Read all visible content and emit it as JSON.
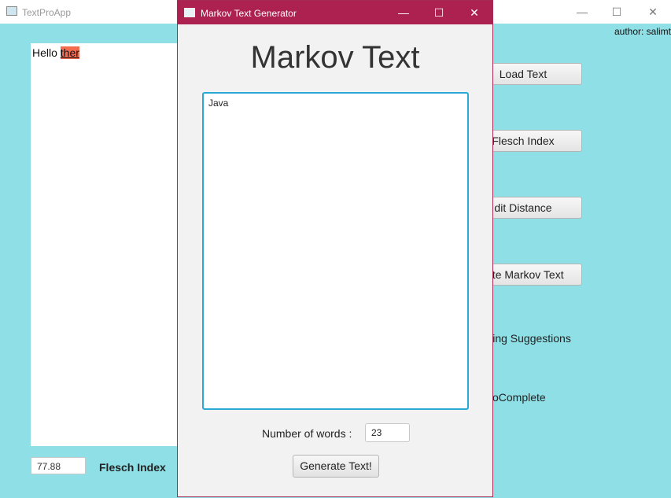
{
  "main_window": {
    "title": "TextProApp",
    "controls": {
      "minimize": "—",
      "maximize": "☐",
      "close": "✕"
    },
    "author": "author: salimt",
    "text": {
      "plain": "Hello ",
      "misspelled": "ther"
    },
    "flesch_value": "77.88",
    "flesch_label": "Flesch Index",
    "buttons": {
      "load_text": "Load Text",
      "flesch_index": "Flesch Index",
      "edit_distance": "dit Distance",
      "generate_markov": "rate Markov Text"
    },
    "labels": {
      "spelling_suggestions": "lling Suggestions",
      "autocomplete": "oComplete"
    }
  },
  "dialog": {
    "title": "Markov Text Generator",
    "controls": {
      "minimize": "—",
      "maximize": "☐",
      "close": "✕"
    },
    "heading": "Markov Text",
    "generated_text": "Java",
    "words_label": "Number of words :",
    "words_value": "23",
    "generate_button": "Generate Text!"
  },
  "colors": {
    "background": "#8fdfe6",
    "dialog_titlebar": "#ad2150",
    "highlight": "#f36c4f",
    "focus_border": "#2aa8d6"
  },
  "icons": {
    "app": "window-app-icon",
    "minimize": "minimize-icon",
    "maximize": "maximize-icon",
    "close": "close-icon"
  }
}
